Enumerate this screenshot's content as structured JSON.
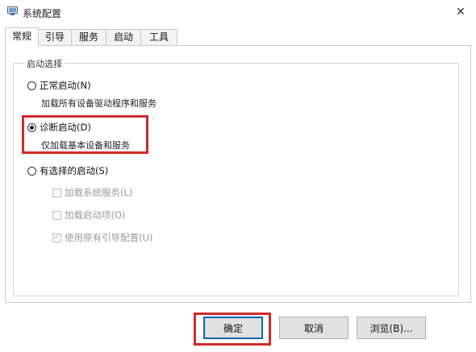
{
  "window": {
    "title": "系统配置",
    "icon": "msconfig-icon",
    "close_glyph": "✕"
  },
  "tabs": [
    {
      "label": "常规",
      "active": true
    },
    {
      "label": "引导",
      "active": false
    },
    {
      "label": "服务",
      "active": false
    },
    {
      "label": "启动",
      "active": false
    },
    {
      "label": "工具",
      "active": false
    }
  ],
  "startup_selection": {
    "legend": "启动选择",
    "normal": {
      "label": "正常启动(N)",
      "description": "加载所有设备驱动程序和服务",
      "selected": false
    },
    "diagnostic": {
      "label": "诊断启动(D)",
      "description": "仅加载基本设备和服务",
      "selected": true
    },
    "selective": {
      "label": "有选择的启动(S)",
      "selected": false,
      "options": {
        "load_system_services": {
          "label": "加载系统服务(L)",
          "checked": false,
          "enabled": false
        },
        "load_startup_items": {
          "label": "加载启动项(O)",
          "checked": false,
          "enabled": false
        },
        "use_original_boot_config": {
          "label": "使用原有引导配置(U)",
          "checked": true,
          "enabled": false
        }
      }
    }
  },
  "buttons": {
    "ok": "确定",
    "cancel": "取消",
    "browse": "浏览(B)..."
  },
  "colors": {
    "highlight": "#d42a2a",
    "primary_border": "#0a64ad"
  },
  "check_glyph": "✓"
}
